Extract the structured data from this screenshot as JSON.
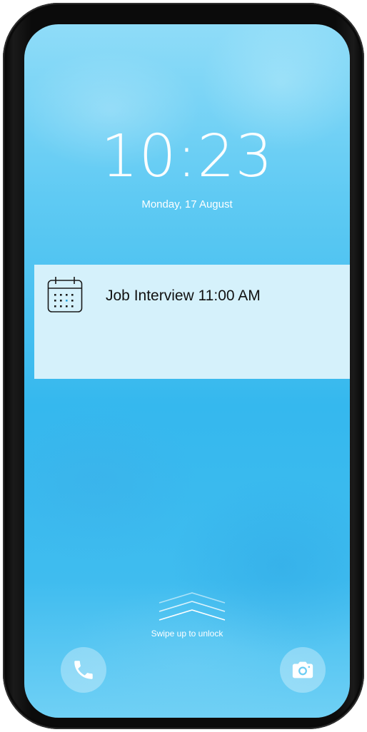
{
  "lock_screen": {
    "time": "10:23",
    "date": "Monday, 17 August"
  },
  "notification": {
    "icon": "calendar-icon",
    "text": "Job Interview 11:00 AM"
  },
  "unlock_hint": {
    "icon": "swipe-up-chevrons-icon",
    "text": "Swipe up to unlock"
  },
  "shortcuts": {
    "left_icon": "phone-icon",
    "right_icon": "camera-icon"
  },
  "colors": {
    "wallpaper_accent": "#35b8ee",
    "notification_background": "#d5f1fb",
    "text_light": "#ffffff",
    "text_dark": "#111111"
  }
}
